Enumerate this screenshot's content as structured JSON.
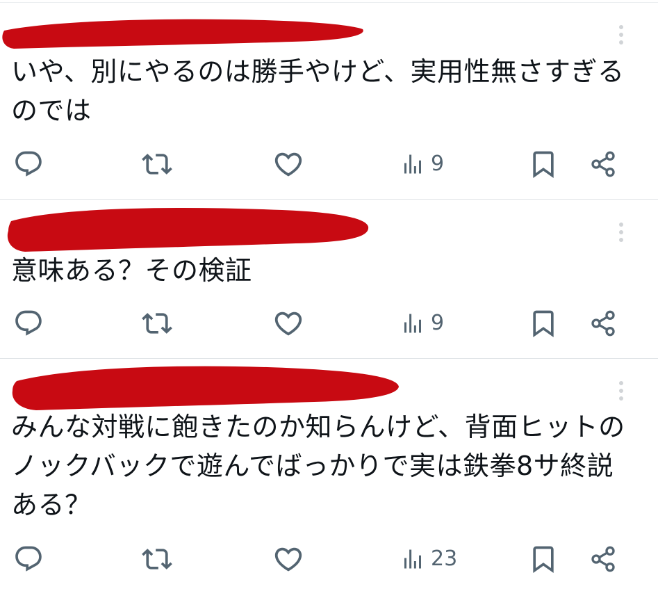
{
  "posts": [
    {
      "text": "いや、別にやるのは勝手やけど、実用性無さすぎるのでは",
      "views": "9"
    },
    {
      "text": "意味ある？その検証",
      "views": "9"
    },
    {
      "text": "みんな対戦に飽きたのか知らんけど、背面ヒットのノックバックで遊んでばっかりで実は鉄拳8サ終説ある？",
      "views": "23"
    }
  ],
  "colors": {
    "redaction": "#c80a12",
    "icon": "#536471",
    "divider": "#dfe3e6"
  },
  "icons": [
    "reply-icon",
    "repost-icon",
    "like-icon",
    "views-icon",
    "bookmark-icon",
    "share-icon",
    "more-icon"
  ]
}
